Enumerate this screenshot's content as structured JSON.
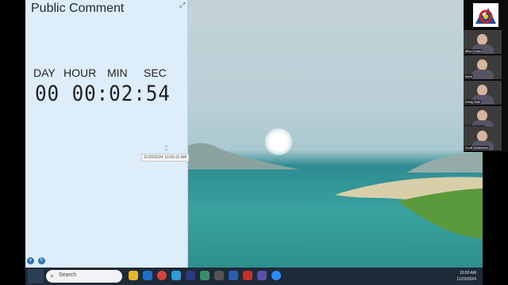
{
  "widget": {
    "title": "Public Comment",
    "expand_glyph": "⤢",
    "labels": {
      "day": "DAY",
      "hour": "HOUR",
      "min": "MIN",
      "sec": "SEC"
    },
    "countdown": "00 00:02:54",
    "timestamp": "11/20/2024 10:03:31 AM",
    "pause_glyph": "⏸",
    "reset_glyph": "↻"
  },
  "gallery": {
    "participants": [
      {
        "name": "Mike Cross"
      },
      {
        "name": "Mark"
      },
      {
        "name": "Kristy Gatt"
      },
      {
        "name": "Colin Koynes"
      },
      {
        "name": "Scott Schleicher"
      }
    ]
  },
  "taskbar": {
    "search_placeholder": "Search",
    "search_icon": "⌕",
    "time": "10:00 AM",
    "date": "11/20/2024"
  },
  "colors": {
    "widget_bg": "#ddeefa",
    "taskbar_bg": "#1e2a38",
    "accent": "#2f6fb4"
  }
}
